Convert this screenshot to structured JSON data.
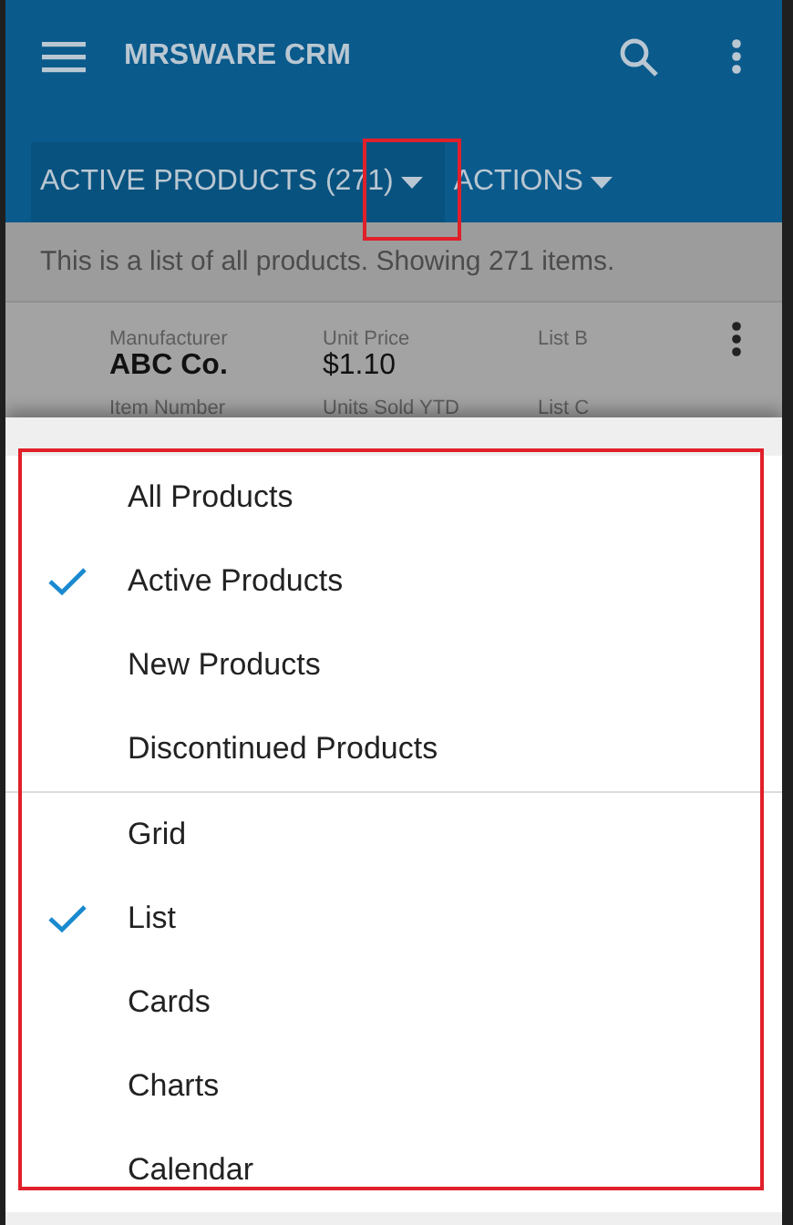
{
  "app_bar": {
    "title": "MRSWARE CRM"
  },
  "filter_bar": {
    "tabs": [
      {
        "label": "ACTIVE PRODUCTS (271)",
        "selected": true,
        "highlighted": true
      },
      {
        "label": "ACTIONS",
        "selected": false,
        "highlighted": false
      }
    ]
  },
  "description": "This is a list of all products. Showing 271 items.",
  "list_item": {
    "fields": [
      {
        "label": "Manufacturer",
        "value": "ABC Co."
      },
      {
        "label": "Unit Price",
        "value": "$1.10"
      },
      {
        "label": "List B"
      },
      {
        "label": "Item Number"
      },
      {
        "label": "Units Sold YTD"
      },
      {
        "label": "List C"
      }
    ]
  },
  "menu": {
    "highlighted": true,
    "groups": [
      {
        "items": [
          {
            "label": "All Products",
            "selected": false
          },
          {
            "label": "Active Products",
            "selected": true
          },
          {
            "label": "New Products",
            "selected": false
          },
          {
            "label": "Discontinued Products",
            "selected": false
          }
        ]
      },
      {
        "items": [
          {
            "label": "Grid",
            "selected": false
          },
          {
            "label": "List",
            "selected": true
          },
          {
            "label": "Cards",
            "selected": false
          },
          {
            "label": "Charts",
            "selected": false
          },
          {
            "label": "Calendar",
            "selected": false
          }
        ]
      }
    ]
  }
}
